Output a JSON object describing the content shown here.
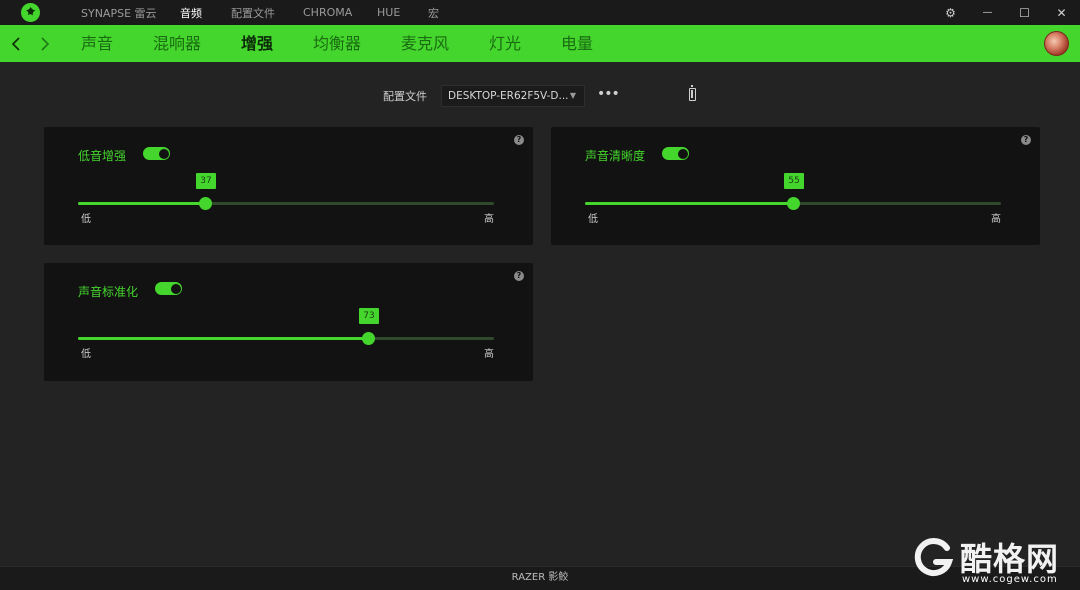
{
  "app": {
    "accent_color": "#44d62c",
    "logo_icon": "razer-logo-icon"
  },
  "titlebar": {
    "items": [
      {
        "label": "SYNAPSE 雷云",
        "active": false
      },
      {
        "label": "音频",
        "active": true
      },
      {
        "label": "配置文件",
        "active": false
      },
      {
        "label": "CHROMA",
        "active": false
      },
      {
        "label": "HUE",
        "active": false
      },
      {
        "label": "宏",
        "active": false
      }
    ],
    "controls": {
      "settings_icon": "⚙",
      "minimize_icon": "—",
      "maximize_icon": "☐",
      "close_icon": "✕"
    }
  },
  "nav": {
    "back_icon": "❮",
    "forward_icon": "❯",
    "tabs": [
      {
        "label": "声音",
        "active": false
      },
      {
        "label": "混响器",
        "active": false
      },
      {
        "label": "增强",
        "active": true
      },
      {
        "label": "均衡器",
        "active": false
      },
      {
        "label": "麦克风",
        "active": false
      },
      {
        "label": "灯光",
        "active": false
      },
      {
        "label": "电量",
        "active": false
      }
    ]
  },
  "profile": {
    "label": "配置文件",
    "selected": "DESKTOP-ER62F5V-D...",
    "more_label": "•••"
  },
  "panels": {
    "bass_boost": {
      "label": "低音增强",
      "enabled": true,
      "value": "37",
      "low": "低",
      "high": "高",
      "help": "?"
    },
    "voice_clarity": {
      "label": "声音清晰度",
      "enabled": true,
      "value": "55",
      "low": "低",
      "high": "高",
      "help": "?"
    },
    "sound_normalization": {
      "label": "声音标准化",
      "enabled": true,
      "value": "73",
      "low": "低",
      "high": "高",
      "help": "?"
    }
  },
  "footer": {
    "label": "RAZER 影鲛"
  },
  "watermark": {
    "name": "酷格网",
    "url": "www.cogew.com"
  }
}
